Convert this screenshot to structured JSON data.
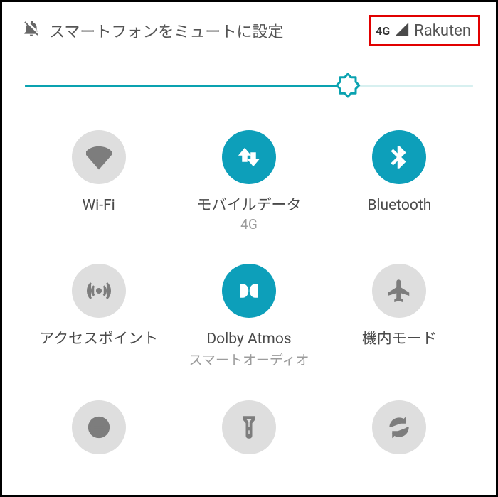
{
  "status": {
    "mute_text": "スマートフォンをミュートに設定",
    "network_type": "4G",
    "carrier": "Rakuten"
  },
  "brightness": {
    "percent": 72
  },
  "tiles": {
    "wifi": {
      "label": "Wi-Fi",
      "sub": "",
      "active": false
    },
    "mobile_data": {
      "label": "モバイルデータ",
      "sub": "4G",
      "active": true
    },
    "bluetooth": {
      "label": "Bluetooth",
      "sub": "",
      "active": true
    },
    "hotspot": {
      "label": "アクセスポイント",
      "sub": "",
      "active": false
    },
    "dolby": {
      "label": "Dolby Atmos",
      "sub": "スマートオーディオ",
      "active": true
    },
    "airplane": {
      "label": "機内モード",
      "sub": "",
      "active": false
    },
    "dnd": {
      "label": "",
      "sub": "",
      "active": false
    },
    "flashlight": {
      "label": "",
      "sub": "",
      "active": false
    },
    "rotate": {
      "label": "",
      "sub": "",
      "active": false
    }
  },
  "colors": {
    "accent": "#0d9fba",
    "inactive_bg": "#dedede",
    "highlight_border": "#e10000"
  }
}
